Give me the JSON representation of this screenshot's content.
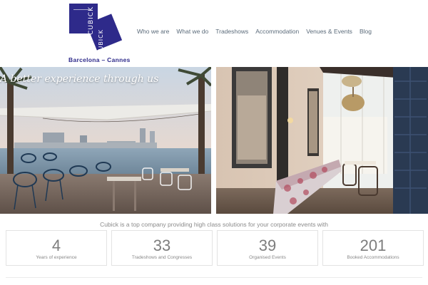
{
  "logo": {
    "brand_top": "CUBICK",
    "brand_bottom": "CUBICK",
    "city": "Barcelona – Cannes",
    "color": "#2e2a8a"
  },
  "nav": {
    "items": [
      "Who we are",
      "What we do",
      "Tradeshows",
      "Accommodation",
      "Venues & Events",
      "Blog"
    ]
  },
  "hero": {
    "caption": "A better experience through us"
  },
  "intro": "Cubick is a top company providing high class solutions for your corporate events with",
  "stats": [
    {
      "value": "4",
      "label": "Years of experience"
    },
    {
      "value": "33",
      "label": "Tradeshows and Congresses"
    },
    {
      "value": "39",
      "label": "Organised Events"
    },
    {
      "value": "201",
      "label": "Booked Accommodations"
    }
  ]
}
